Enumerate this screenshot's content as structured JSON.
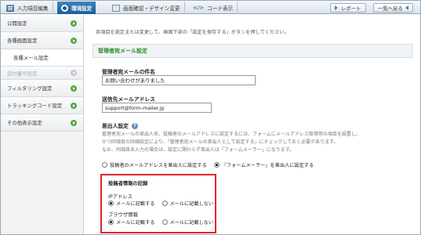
{
  "tabs": [
    {
      "label": "入力項目編集",
      "icon": "list-icon"
    },
    {
      "label": "環境設定",
      "icon": "gear-icon",
      "active": true
    },
    {
      "label": "画面確認・デザイン変更",
      "icon": "screen-icon"
    },
    {
      "label": "コード表示",
      "icon": "code-icon"
    }
  ],
  "header_buttons": {
    "report": "レポート",
    "back": "一覧へ戻る"
  },
  "sidebar": {
    "items": [
      {
        "label": "公開設定"
      },
      {
        "label": "各種画面設定"
      },
      {
        "label": "各種メール設定"
      },
      {
        "label": "受付番号設定"
      },
      {
        "label": "フィルタリング設定"
      },
      {
        "label": "トラッキングコード設定"
      },
      {
        "label": "その他表示設定"
      }
    ]
  },
  "main": {
    "intro": "各項目を設定または変更して、画面下部の「設定を保存する」ボタンを押してください。",
    "section_title": "管理者宛メール設定",
    "subject_label": "管理者宛メールの件名",
    "subject_value": "お問い合わせがありました",
    "to_label": "送信先メールアドレス",
    "to_value": "support@form-mailer.jp",
    "from_label": "差出人設定",
    "from_para": [
      "管理者宛メールの差出人名、投稿者のメールアドレスに設定するには、フォームにメールアドレス取得用の項目を設置し、",
      "かつ同項目の詳細設定により、「管理者宛メールの差出人として設定する」にチェックしておく必要があります。",
      "なお、同項目未入力の場合は、設定に関わらず差出人は「フォームメーラー」になります。"
    ],
    "from_options": [
      "投稿者のメールアドレスを差出人に設定する",
      "「フォームメーラー」を差出人に設定する"
    ],
    "record_title": "投稿者情報の記録",
    "ip_label": "IPアドレス",
    "browser_label": "ブラウザ情報",
    "record_options": [
      "メールに記載する",
      "メールに記載しない"
    ]
  },
  "colors": {
    "accent": "#1c5d99",
    "section_green": "#2b8a2b",
    "highlight_red": "#e2272b"
  }
}
